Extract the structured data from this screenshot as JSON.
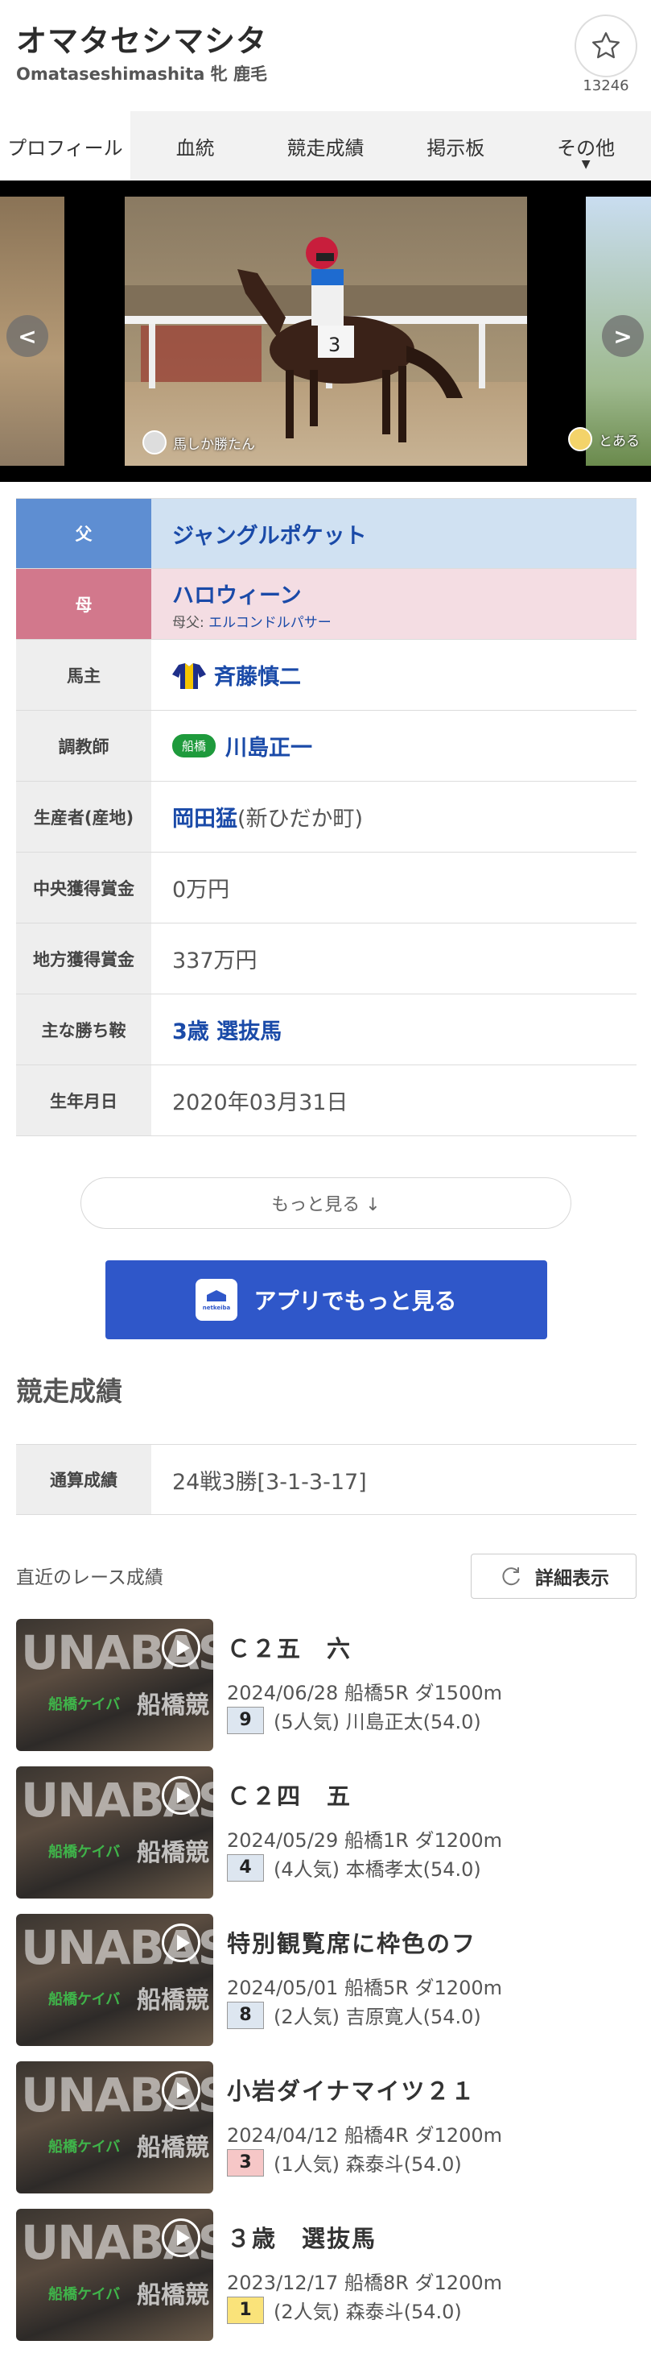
{
  "header": {
    "horse_name": "オマタセシマシタ",
    "horse_sub": "Omataseshimashita 牝 鹿毛",
    "favorite_count": "13246"
  },
  "tabs": [
    {
      "label": "プロフィール"
    },
    {
      "label": "血統"
    },
    {
      "label": "競走成績"
    },
    {
      "label": "掲示板"
    },
    {
      "label": "その他"
    }
  ],
  "carousel": {
    "main_credit": "馬しか勝たん",
    "right_credit": "とある",
    "prev_label": "<",
    "next_label": ">"
  },
  "profile": {
    "father_label": "父",
    "father": "ジャングルポケット",
    "mother_label": "母",
    "mother": "ハロウィーン",
    "mother_sire_label": "母父:",
    "mother_sire": "エルコンドルパサー",
    "owner_label": "馬主",
    "owner": "斉藤慎二",
    "trainer_label": "調教師",
    "trainer_badge": "船橋",
    "trainer": "川島正一",
    "breeder_label": "生産者(産地)",
    "breeder": "岡田猛",
    "breeder_region": "(新ひだか町)",
    "central_prize_label": "中央獲得賞金",
    "central_prize": "0万円",
    "local_prize_label": "地方獲得賞金",
    "local_prize": "337万円",
    "main_wins_label": "主な勝ち鞍",
    "main_wins": "3歳 選抜馬",
    "birthdate_label": "生年月日",
    "birthdate": "2020年03月31日"
  },
  "buttons": {
    "more": "もっと見る ↓",
    "app_more": "アプリでもっと見る",
    "app_icon_text": "netkeiba",
    "detail": "詳細表示"
  },
  "results": {
    "section_title": "競走成績",
    "total_label": "通算成績",
    "total_value": "24戦3勝[3-1-3-17]",
    "recent_label": "直近のレース成績",
    "thumb_watermark": "UNABAS",
    "thumb_logo": "船橋ケイバ",
    "thumb_logo2": "船橋競",
    "races": [
      {
        "name": "Ｃ２五　六",
        "info": "2024/06/28 船橋5R ダ1500m",
        "position": "9",
        "result": "(5人気) 川島正太(54.0)",
        "pos_class": "normal"
      },
      {
        "name": "Ｃ２四　五",
        "info": "2024/05/29 船橋1R ダ1200m",
        "position": "4",
        "result": "(4人気) 本橋孝太(54.0)",
        "pos_class": "normal"
      },
      {
        "name": "特別観覧席に枠色のフ",
        "info": "2024/05/01 船橋5R ダ1200m",
        "position": "8",
        "result": "(2人気) 吉原寛人(54.0)",
        "pos_class": "normal"
      },
      {
        "name": "小岩ダイナマイツ２１",
        "info": "2024/04/12 船橋4R ダ1200m",
        "position": "3",
        "result": "(1人気) 森泰斗(54.0)",
        "pos_class": "third"
      },
      {
        "name": "３歳　選抜馬",
        "info": "2023/12/17 船橋8R ダ1200m",
        "position": "1",
        "result": "(2人気) 森泰斗(54.0)",
        "pos_class": "first"
      }
    ]
  },
  "colors": {
    "father_header": "#5e8ed2",
    "mother_header": "#d2788c",
    "app_button": "#2f57c9",
    "link": "#1a4aa8",
    "trainer_badge": "#1e9a3c"
  }
}
